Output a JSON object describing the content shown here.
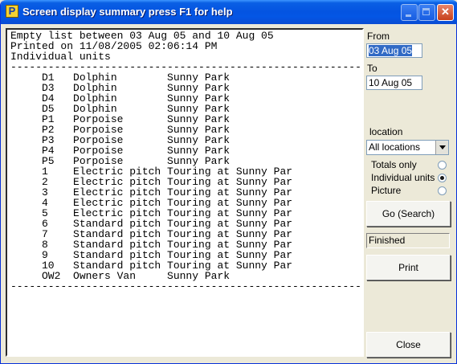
{
  "window": {
    "title": "Screen display summary press F1 for help",
    "app_icon": "P"
  },
  "titlebar_buttons": [
    "minimize-icon",
    "maximize-icon",
    "close-icon"
  ],
  "report": {
    "header_lines": [
      "Empty list between 03 Aug 05 and 10 Aug 05",
      "Printed on 11/08/2005 02:06:14 PM",
      "Individual units"
    ],
    "separator": "------------------------------------------------------------",
    "rows": [
      {
        "unit": "D1",
        "type": "Dolphin",
        "location": "Sunny Park"
      },
      {
        "unit": "D3",
        "type": "Dolphin",
        "location": "Sunny Park"
      },
      {
        "unit": "D4",
        "type": "Dolphin",
        "location": "Sunny Park"
      },
      {
        "unit": "D5",
        "type": "Dolphin",
        "location": "Sunny Park"
      },
      {
        "unit": "P1",
        "type": "Porpoise",
        "location": "Sunny Park"
      },
      {
        "unit": "P2",
        "type": "Porpoise",
        "location": "Sunny Park"
      },
      {
        "unit": "P3",
        "type": "Porpoise",
        "location": "Sunny Park"
      },
      {
        "unit": "P4",
        "type": "Porpoise",
        "location": "Sunny Park"
      },
      {
        "unit": "P5",
        "type": "Porpoise",
        "location": "Sunny Park"
      },
      {
        "unit": "1",
        "type": "Electric pitch",
        "location": "Touring at Sunny Par"
      },
      {
        "unit": "2",
        "type": "Electric pitch",
        "location": "Touring at Sunny Par"
      },
      {
        "unit": "3",
        "type": "Electric pitch",
        "location": "Touring at Sunny Par"
      },
      {
        "unit": "4",
        "type": "Electric pitch",
        "location": "Touring at Sunny Par"
      },
      {
        "unit": "5",
        "type": "Electric pitch",
        "location": "Touring at Sunny Par"
      },
      {
        "unit": "6",
        "type": "Standard pitch",
        "location": "Touring at Sunny Par"
      },
      {
        "unit": "7",
        "type": "Standard pitch",
        "location": "Touring at Sunny Par"
      },
      {
        "unit": "8",
        "type": "Standard pitch",
        "location": "Touring at Sunny Par"
      },
      {
        "unit": "9",
        "type": "Standard pitch",
        "location": "Touring at Sunny Par"
      },
      {
        "unit": "10",
        "type": "Standard pitch",
        "location": "Touring at Sunny Par"
      },
      {
        "unit": "OW2",
        "type": "Owners Van",
        "location": "Sunny Park"
      }
    ]
  },
  "panel": {
    "from_label": "From",
    "from_value": "03 Aug 05",
    "to_label": "To",
    "to_value": "10 Aug 05",
    "location_label": "location",
    "location_value": "All locations",
    "options": [
      {
        "label": "Totals only",
        "selected": false
      },
      {
        "label": "Individual units",
        "selected": true
      },
      {
        "label": "Picture",
        "selected": false
      }
    ],
    "go_label": "Go (Search)",
    "status": "Finished",
    "print_label": "Print",
    "close_label": "Close"
  },
  "colors": {
    "titlebar": "#0454E1",
    "face": "#ECE9D8",
    "selection": "#316AC5"
  }
}
